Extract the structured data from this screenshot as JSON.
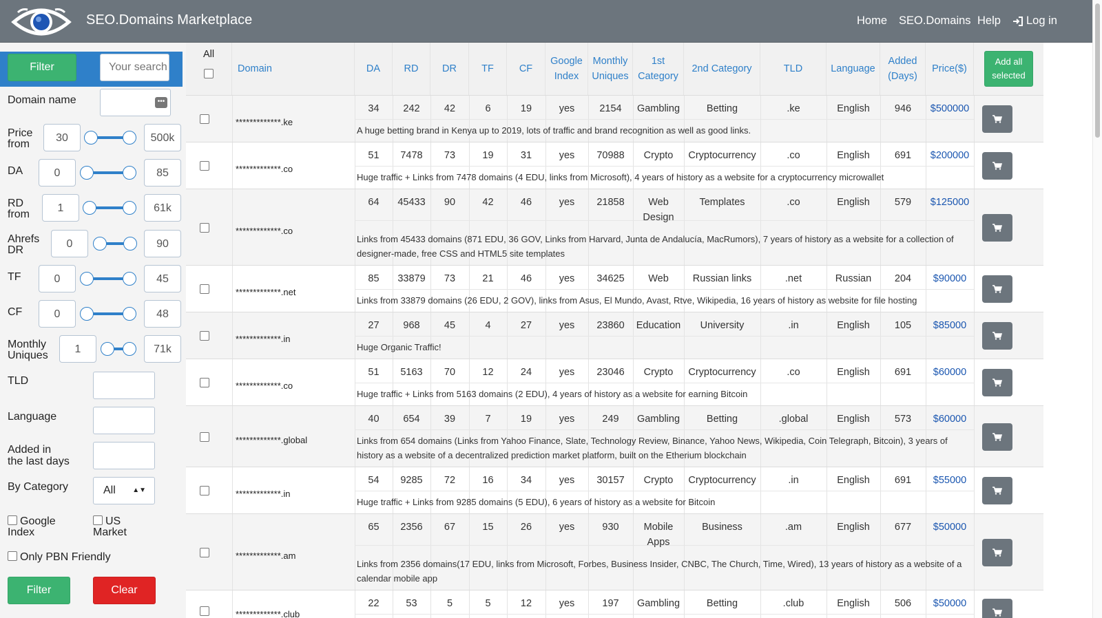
{
  "header": {
    "brand": "SEO.Domains Marketplace",
    "nav": [
      "Home",
      "SEO.Domains",
      "Help",
      "Log in"
    ]
  },
  "sidebar": {
    "filter_label": "Filter",
    "search_placeholder": "Your search",
    "domain_name_label": "Domain name",
    "ranges": [
      {
        "label1": "Price",
        "label2": "from",
        "min": "30",
        "max": "500k"
      },
      {
        "label1": "DA",
        "label2": "",
        "min": "0",
        "max": "85"
      },
      {
        "label1": "RD",
        "label2": "from",
        "min": "1",
        "max": "61k"
      },
      {
        "label1": "Ahrefs",
        "label2": "DR",
        "min": "0",
        "max": "90"
      },
      {
        "label1": "TF",
        "label2": "",
        "min": "0",
        "max": "45"
      },
      {
        "label1": "CF",
        "label2": "",
        "min": "0",
        "max": "48"
      },
      {
        "label1": "Monthly",
        "label2": "Uniques",
        "min": "1",
        "max": "71k"
      }
    ],
    "tld_label": "TLD",
    "language_label": "Language",
    "added_label1": "Added in",
    "added_label2": "the last days",
    "category_label": "By Category",
    "category_value": "All",
    "google_index_1": "Google",
    "google_index_2": "Index",
    "us_market_1": "US",
    "us_market_2": "Market",
    "pbn_label": "Only PBN Friendly",
    "filter_button": "Filter",
    "clear_button": "Clear"
  },
  "table": {
    "headers": {
      "all": "All",
      "domain": "Domain",
      "da": "DA",
      "rd": "RD",
      "dr": "DR",
      "tf": "TF",
      "cf": "CF",
      "google1": "Google",
      "google2": "Index",
      "monthly1": "Monthly",
      "monthly2": "Uniques",
      "cat1a": "1st",
      "cat1b": "Category",
      "cat2": "2nd Category",
      "tld": "TLD",
      "language": "Language",
      "added1": "Added",
      "added2": "(Days)",
      "price": "Price($)",
      "add_all1": "Add all",
      "add_all2": "selected"
    },
    "rows": [
      {
        "domain": "*************.ke",
        "da": "34",
        "rd": "242",
        "dr": "42",
        "tf": "6",
        "cf": "19",
        "google": "yes",
        "uniques": "2154",
        "cat1": "Gambling",
        "cat2": "Betting",
        "tld": ".ke",
        "lang": "English",
        "added": "946",
        "price": "$500000",
        "desc1": "A huge betting brand in Kenya up to 2019, lots of traffic and brand recognition as well as good links.",
        "desc2": ""
      },
      {
        "domain": "*************.co",
        "da": "51",
        "rd": "7478",
        "dr": "73",
        "tf": "19",
        "cf": "31",
        "google": "yes",
        "uniques": "70988",
        "cat1": "Crypto",
        "cat2": "Cryptocurrency",
        "tld": ".co",
        "lang": "English",
        "added": "691",
        "price": "$200000",
        "desc1": "Huge traffic + Links from 7478 domains (4 EDU, links from Microsoft), 4 years of history as a website for a cryptocurrency microwallet",
        "desc2": ""
      },
      {
        "domain": "*************.co",
        "da": "64",
        "rd": "45433",
        "dr": "90",
        "tf": "42",
        "cf": "46",
        "google": "yes",
        "uniques": "21858",
        "cat1": "Web",
        "cat1b": "Design",
        "cat2": "Templates",
        "tld": ".co",
        "lang": "English",
        "added": "579",
        "price": "$125000",
        "desc1": "Links from 45433 domains (871 EDU, 36 GOV, Links from Harvard, Junta de Andalucía, MacRumors), 7 years of history as a website for a collection of",
        "desc2": "designer-made, free CSS and HTML5 site templates"
      },
      {
        "domain": "*************.net",
        "da": "85",
        "rd": "33879",
        "dr": "73",
        "tf": "21",
        "cf": "46",
        "google": "yes",
        "uniques": "34625",
        "cat1": "Web",
        "cat2": "Russian links",
        "tld": ".net",
        "lang": "Russian",
        "added": "204",
        "price": "$90000",
        "desc1": "Links from 33879 domains (26 EDU, 2 GOV), links from Asus, El Mundo, Avast, Rtve, Wikipedia, 16 years of history as website for file hosting",
        "desc2": ""
      },
      {
        "domain": "*************.in",
        "da": "27",
        "rd": "968",
        "dr": "45",
        "tf": "4",
        "cf": "27",
        "google": "yes",
        "uniques": "23860",
        "cat1": "Education",
        "cat2": "University",
        "tld": ".in",
        "lang": "English",
        "added": "105",
        "price": "$85000",
        "desc1": "Huge Organic Traffic!",
        "desc2": ""
      },
      {
        "domain": "*************.co",
        "da": "51",
        "rd": "5163",
        "dr": "70",
        "tf": "12",
        "cf": "24",
        "google": "yes",
        "uniques": "23046",
        "cat1": "Crypto",
        "cat2": "Cryptocurrency",
        "tld": ".co",
        "lang": "English",
        "added": "691",
        "price": "$60000",
        "desc1": "Huge traffic + Links from 5163 domains (2 EDU), 4 years of history as a website for earning Bitcoin",
        "desc2": ""
      },
      {
        "domain": "*************.global",
        "da": "40",
        "rd": "654",
        "dr": "39",
        "tf": "7",
        "cf": "19",
        "google": "yes",
        "uniques": "249",
        "cat1": "Gambling",
        "cat2": "Betting",
        "tld": ".global",
        "lang": "English",
        "added": "573",
        "price": "$60000",
        "desc1": "Links from 654 domains (Links from Yahoo Finance, Slate, Technology Review, Binance, Yahoo News, Wikipedia, Coin Telegraph, Bitcoin), 3 years of",
        "desc2": "history as a website of a decentralized prediction market platform, built on the Etherium blockchain"
      },
      {
        "domain": "*************.in",
        "da": "54",
        "rd": "9285",
        "dr": "72",
        "tf": "16",
        "cf": "34",
        "google": "yes",
        "uniques": "30157",
        "cat1": "Crypto",
        "cat2": "Cryptocurrency",
        "tld": ".in",
        "lang": "English",
        "added": "691",
        "price": "$55000",
        "desc1": "Huge traffic + Links from 9285 domains (5 EDU), 6 years of history as a website for Bitcoin",
        "desc2": ""
      },
      {
        "domain": "*************.am",
        "da": "65",
        "rd": "2356",
        "dr": "67",
        "tf": "15",
        "cf": "26",
        "google": "yes",
        "uniques": "930",
        "cat1": "Mobile",
        "cat1b": "Apps",
        "cat2": "Business",
        "tld": ".am",
        "lang": "English",
        "added": "677",
        "price": "$50000",
        "desc1": "Links from 2356 domains(17 EDU, links from Microsoft, Forbes, Business Insider, CNBC, The Church, Time, Wired), 13 years of history as a website of a",
        "desc2": "calendar mobile app"
      },
      {
        "domain": "*************.club",
        "da": "22",
        "rd": "53",
        "dr": "5",
        "tf": "5",
        "cf": "12",
        "google": "yes",
        "uniques": "197",
        "cat1": "Gambling",
        "cat2": "Betting",
        "tld": ".club",
        "lang": "English",
        "added": "506",
        "price": "$50000",
        "desc1": "",
        "desc2": ""
      }
    ]
  },
  "colors": {
    "navbar": "#6c757d",
    "accent": "#2f80c9",
    "green": "#3cb371",
    "red": "#e02424",
    "link": "#1a56b0"
  }
}
